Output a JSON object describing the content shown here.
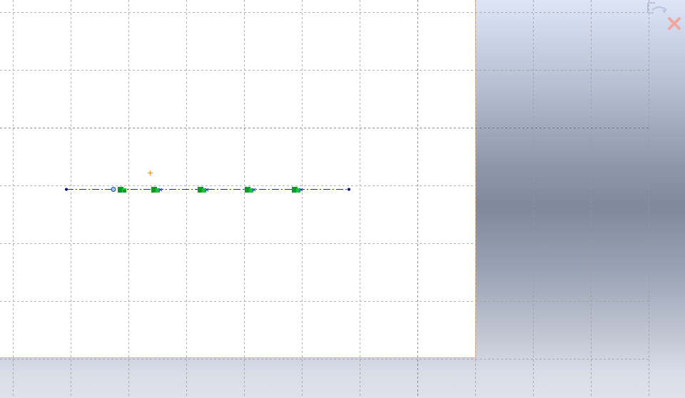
{
  "app": {
    "view": "sketch-drawing-area",
    "colors": {
      "sheet_background": "#ffffff",
      "sheet_border": "#f0b37a",
      "grid_line": "#9a9a9a",
      "sketch_line": "#1f2fb4",
      "sketch_point": "#00008b",
      "constraint_glyph": "#0b9a2a",
      "origin_marker": "#f08a1c",
      "exit_icon": "#f0a7a0"
    }
  },
  "sketch": {
    "line_style": "dash-dot centerline",
    "constraint_count": 5,
    "endpoint_count": 2
  },
  "icons": {
    "confirm_corner": "sketch-confirm-icon",
    "cancel_corner": "cancel-x-icon",
    "origin": "origin-plus-icon"
  }
}
